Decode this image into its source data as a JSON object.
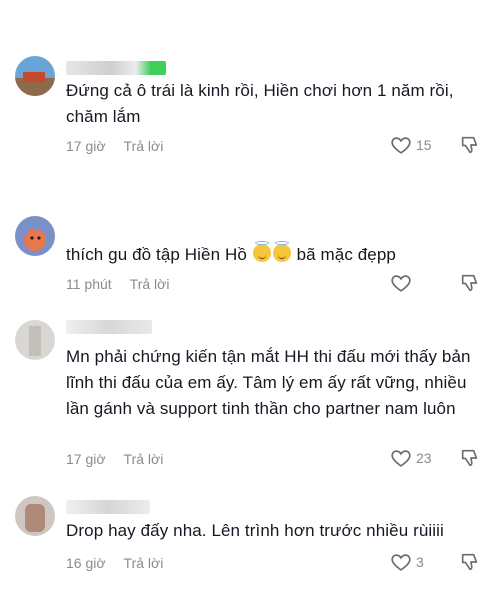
{
  "comments": [
    {
      "text": "Đứng cả ô trái là kinh rồi, Hiền chơi hơn 1 năm rồi, chăm lắm",
      "time": "17 giờ",
      "reply": "Trả lời",
      "likes": "15"
    },
    {
      "text_prefix": "thích gu đồ tập Hiền Hồ",
      "text_suffix": " bã mặc đẹpp",
      "emoji": "halo-smile-emoji",
      "time": "11 phút",
      "reply": "Trả lời",
      "likes": ""
    },
    {
      "text": "Mn phải chứng kiến tận mắt HH thi đấu mới thấy bản lĩnh thi đấu của em ấy. Tâm lý em ấy rất vững, nhiều lần gánh và support tinh thần cho partner nam luôn",
      "time": "17 giờ",
      "reply": "Trả lời",
      "likes": "23"
    },
    {
      "text": "Drop hay đấy nha. Lên trình hơn trước nhiều rùiiii",
      "time": "16 giờ",
      "reply": "Trả lời",
      "likes": "3"
    }
  ],
  "icons": {
    "like": "heart-outline-icon",
    "dislike": "thumbs-down-outline-icon"
  },
  "colors": {
    "text": "#161823",
    "meta": "#8a8b91",
    "background": "#ffffff"
  }
}
